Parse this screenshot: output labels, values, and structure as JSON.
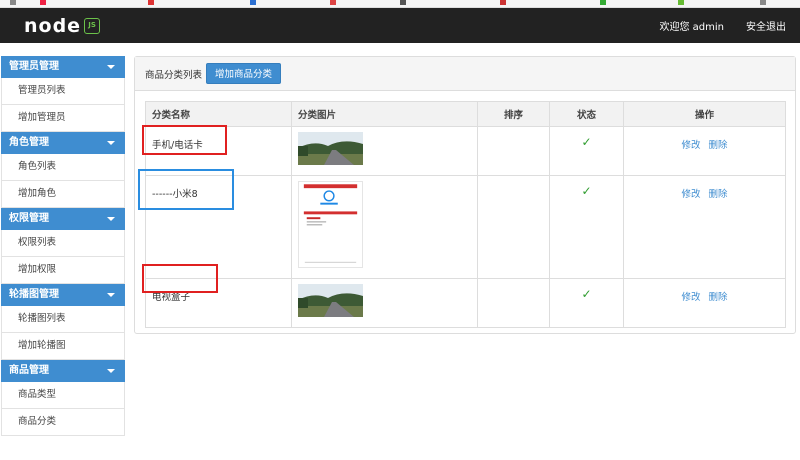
{
  "header": {
    "logo_text": "node",
    "logo_badge": "JS",
    "welcome": "欢迎您 admin",
    "logout": "安全退出"
  },
  "sidebar": {
    "groups": [
      {
        "title": "管理员管理",
        "items": [
          "管理员列表",
          "增加管理员"
        ]
      },
      {
        "title": "角色管理",
        "items": [
          "角色列表",
          "增加角色"
        ]
      },
      {
        "title": "权限管理",
        "items": [
          "权限列表",
          "增加权限"
        ]
      },
      {
        "title": "轮播图管理",
        "items": [
          "轮播图列表",
          "增加轮播图"
        ]
      },
      {
        "title": "商品管理",
        "items": [
          "商品类型",
          "商品分类"
        ]
      }
    ]
  },
  "main": {
    "breadcrumb": "商品分类列表",
    "add_button": "增加商品分类",
    "columns": [
      "分类名称",
      "分类图片",
      "排序",
      "状态",
      "操作"
    ],
    "rows": [
      {
        "name": "手机/电话卡",
        "image": "road-photo",
        "sort": "",
        "status": "✓",
        "edit": "修改",
        "delete": "删除"
      },
      {
        "name": "------小米8",
        "image": "phone-screenshot",
        "sort": "",
        "status": "✓",
        "edit": "修改",
        "delete": "删除"
      },
      {
        "name": "电视盒子",
        "image": "road-photo",
        "sort": "",
        "status": "✓",
        "edit": "修改",
        "delete": "删除"
      }
    ]
  },
  "colors": {
    "topbar": "#222222",
    "accent": "#3f8dd0",
    "check": "#2f9c2f",
    "annotation_red": "#e02020",
    "annotation_blue": "#2a8de0"
  }
}
